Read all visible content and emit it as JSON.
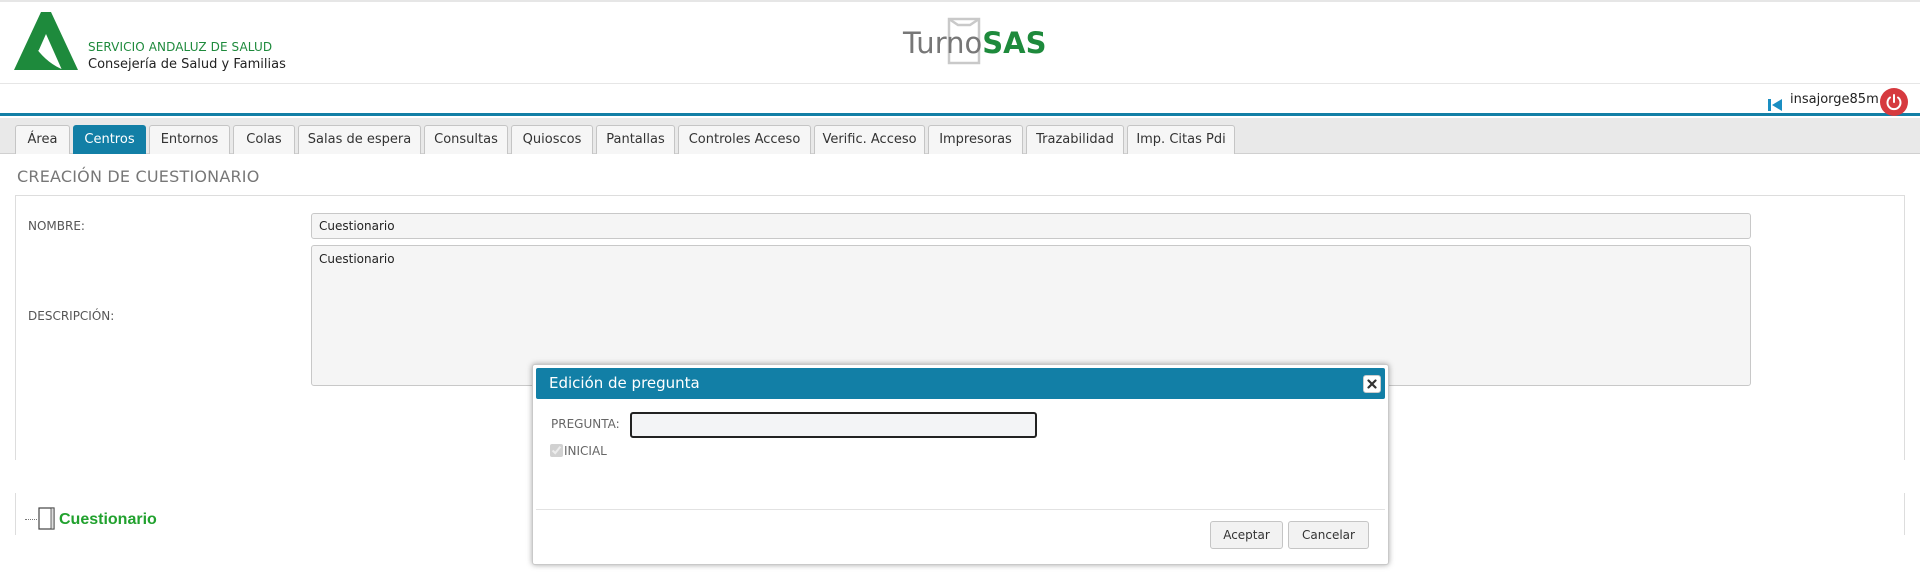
{
  "header": {
    "org_line1": "SERVICIO ANDALUZ DE SALUD",
    "org_line2": "Consejería de Salud y Familias",
    "brand_left": "Turno",
    "brand_right": "SAS",
    "logo_color": "#1e8a3c"
  },
  "userbar": {
    "username": "insajorge85m",
    "back_icon": "skip-back-icon",
    "power_icon": "power-icon",
    "power_color": "#d63a3f"
  },
  "tabs": [
    {
      "label": "Área"
    },
    {
      "label": "Centros",
      "active": true
    },
    {
      "label": "Entornos"
    },
    {
      "label": "Colas"
    },
    {
      "label": "Salas de espera"
    },
    {
      "label": "Consultas"
    },
    {
      "label": "Quioscos"
    },
    {
      "label": "Pantallas"
    },
    {
      "label": "Controles Acceso"
    },
    {
      "label": "Verific. Acceso"
    },
    {
      "label": "Impresoras"
    },
    {
      "label": "Trazabilidad"
    },
    {
      "label": "Imp. Citas Pdi"
    }
  ],
  "form": {
    "title": "CREACIÓN DE CUESTIONARIO",
    "name_label": "NOMBRE:",
    "name_value": "Cuestionario",
    "desc_label": "DESCRIPCIÓN:",
    "desc_value": "Cuestionario"
  },
  "tree": {
    "root_label": "Cuestionario",
    "root_color": "#21a12e"
  },
  "dialog": {
    "title": "Edición de pregunta",
    "question_label": "PREGUNTA:",
    "question_value": "",
    "initial_label": "INICIAL",
    "initial_checked": true,
    "accept_label": "Aceptar",
    "cancel_label": "Cancelar",
    "accent_color": "#127fa6"
  }
}
